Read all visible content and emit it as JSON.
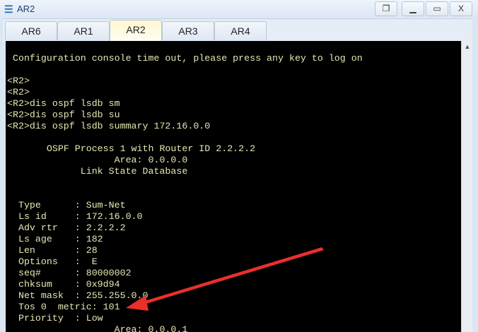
{
  "window": {
    "title": "AR2",
    "icon": "app-icon",
    "buttons": [
      "restore-icon",
      "minimize-icon",
      "maximize-icon",
      "close-icon"
    ]
  },
  "tabs": [
    {
      "label": "AR6"
    },
    {
      "label": "AR1"
    },
    {
      "label": "AR2",
      "active": true
    },
    {
      "label": "AR3"
    },
    {
      "label": "AR4"
    }
  ],
  "terminal": {
    "lines": [
      " Configuration console time out, please press any key to log on",
      "",
      "<R2>",
      "<R2>",
      "<R2>dis ospf lsdb sm",
      "<R2>dis ospf lsdb su",
      "<R2>dis ospf lsdb summary 172.16.0.0",
      "",
      "       OSPF Process 1 with Router ID 2.2.2.2",
      "                   Area: 0.0.0.0",
      "             Link State Database",
      "",
      "",
      "  Type      : Sum-Net",
      "  Ls id     : 172.16.0.0",
      "  Adv rtr   : 2.2.2.2",
      "  Ls age    : 182",
      "  Len       : 28",
      "  Options   :  E",
      "  seq#      : 80000002",
      "  chksum    : 0x9d94",
      "  Net mask  : 255.255.0.0",
      "  Tos 0  metric: 101",
      "  Priority  : Low",
      "                   Area: 0.0.0.1"
    ]
  },
  "colors": {
    "terminal_text": "#e8e6b4",
    "annotation_arrow": "#e8302a"
  }
}
